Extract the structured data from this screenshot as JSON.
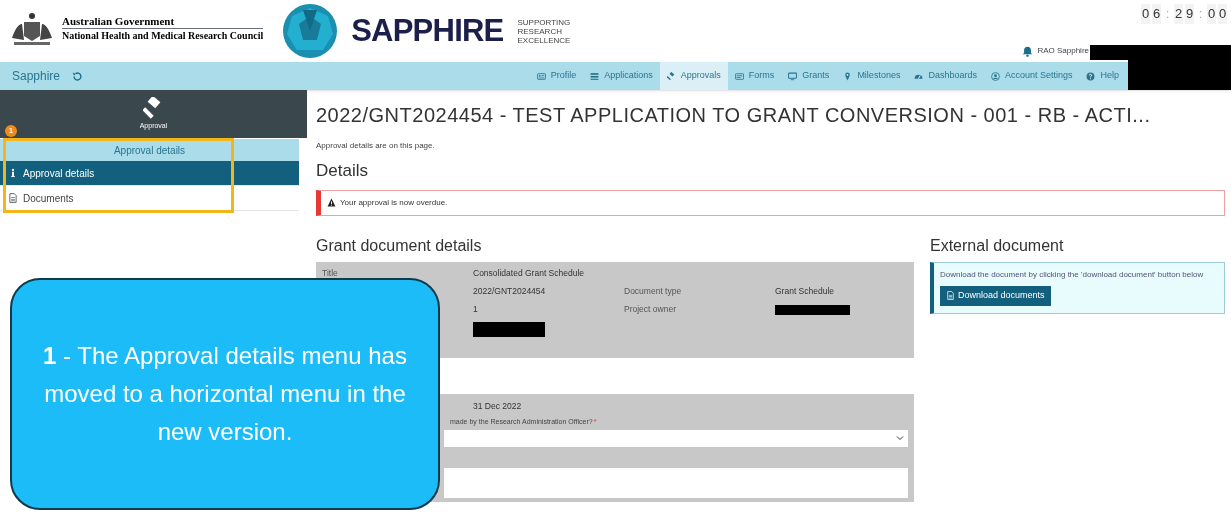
{
  "header": {
    "gov_line1": "Australian Government",
    "gov_line2": "National Health and Medical Research Council",
    "brand": "SAPPHIRE",
    "tagline": [
      "SUPPORTING",
      "RESEARCH",
      "EXCELLENCE"
    ],
    "timer": [
      "0",
      "6",
      ":",
      "2",
      "9",
      ":",
      "0",
      "0"
    ],
    "user": "RAO Sapphire"
  },
  "nav": {
    "home": "Sapphire",
    "items": [
      {
        "label": "Profile",
        "selected": false
      },
      {
        "label": "Applications",
        "selected": false
      },
      {
        "label": "Approvals",
        "selected": true
      },
      {
        "label": "Forms",
        "selected": false
      },
      {
        "label": "Grants",
        "selected": false
      },
      {
        "label": "Milestones",
        "selected": false
      },
      {
        "label": "Dashboards",
        "selected": false
      },
      {
        "label": "Account Settings",
        "selected": false
      },
      {
        "label": "Help",
        "selected": false
      }
    ]
  },
  "sidebar": {
    "title": "Approval",
    "section": "Approval details",
    "items": [
      {
        "label": "Approval details",
        "selected": true
      },
      {
        "label": "Documents",
        "selected": false
      }
    ]
  },
  "page": {
    "title": "2022/GNT2024454 - TEST APPLICATION TO GRANT CONVERSION - 001 - RB - ACTI...",
    "intro": "Approval details are on this page.",
    "details_heading": "Details",
    "alert": "Your approval is now overdue.",
    "grant_heading": "Grant document details",
    "grant_rows": [
      {
        "label": "Title",
        "value": "Consolidated Grant Schedule"
      },
      {
        "value": "2022/GNT2024454",
        "label2": "Document type",
        "value2": "Grant Schedule"
      },
      {
        "value": "1",
        "label2": "Project owner"
      }
    ],
    "second_date": "31 Dec 2022",
    "question": "made by the Research Administration Officer?",
    "required_mark": "*",
    "external_heading": "External document",
    "external_text": "Download the document by clicking the 'download document' button below",
    "download_button": "Download documents"
  },
  "callout": {
    "badge": "1",
    "text": "**1** - The Approval details menu has moved to a horizontal menu in the new version."
  }
}
